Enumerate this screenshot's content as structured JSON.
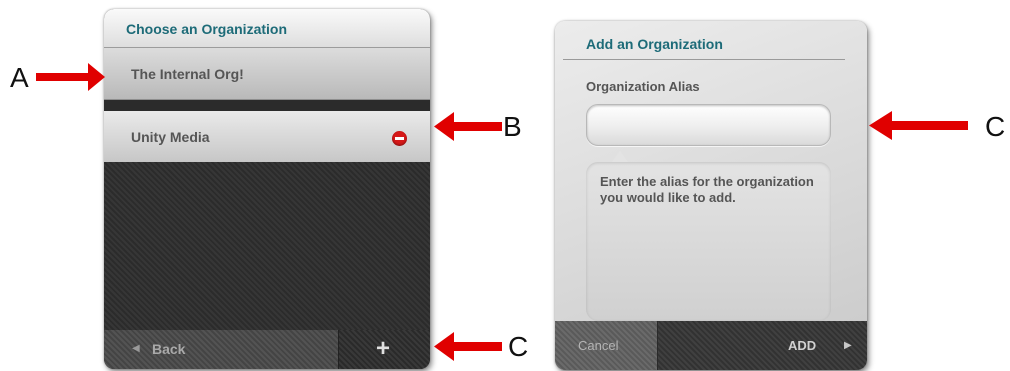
{
  "left_panel": {
    "header": "Choose an Organization",
    "organizations": [
      {
        "label": "The Internal Org!"
      },
      {
        "label": "Unity Media"
      }
    ],
    "back_label": "Back",
    "back_icon": "left-triangle",
    "add_label": "+",
    "delete_icon": "minus-circle-icon"
  },
  "right_panel": {
    "title": "Add an Organization",
    "alias_label": "Organization Alias",
    "alias_value": "",
    "tip": "Enter the alias for the organization you would like to add.",
    "cancel_label": "Cancel",
    "add_label": "ADD",
    "add_icon": "right-triangle"
  },
  "annotations": {
    "a": "A",
    "b": "B",
    "c_left": "C",
    "c_right": "C"
  },
  "colors": {
    "header_text": "#1d6b78",
    "delete_icon": "#d61818",
    "annotation_arrow": "#e00000"
  }
}
